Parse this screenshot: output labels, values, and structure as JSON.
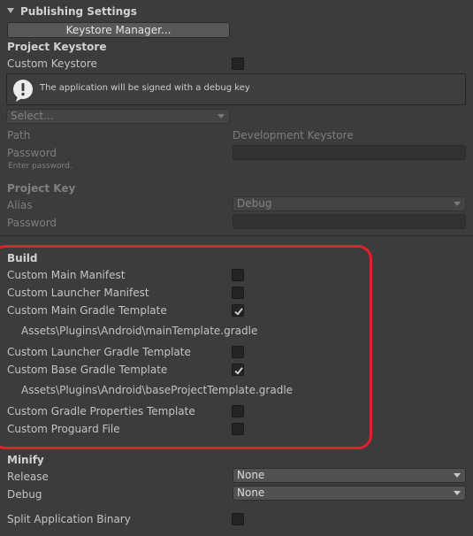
{
  "section": {
    "title": "Publishing Settings",
    "keystore_manager_button": "Keystore Manager..."
  },
  "project_keystore": {
    "heading": "Project Keystore",
    "custom_keystore_label": "Custom Keystore",
    "custom_keystore_checked": false,
    "info_message": "The application will be signed with a debug key",
    "select_value": "Select...",
    "path_label": "Path",
    "path_value": "Development Keystore",
    "password_label": "Password",
    "password_hint": "Enter password."
  },
  "project_key": {
    "heading": "Project Key",
    "alias_label": "Alias",
    "alias_value": "Debug",
    "password_label": "Password"
  },
  "build": {
    "heading": "Build",
    "items": [
      {
        "label": "Custom Main Manifest",
        "checked": false
      },
      {
        "label": "Custom Launcher Manifest",
        "checked": false
      },
      {
        "label": "Custom Main Gradle Template",
        "checked": true
      },
      {
        "label": "Custom Launcher Gradle Template",
        "checked": false
      },
      {
        "label": "Custom Base Gradle Template",
        "checked": true
      },
      {
        "label": "Custom Gradle Properties Template",
        "checked": false
      },
      {
        "label": "Custom Proguard File",
        "checked": false
      }
    ],
    "main_gradle_path": "Assets\\Plugins\\Android\\mainTemplate.gradle",
    "base_gradle_path": "Assets\\Plugins\\Android\\baseProjectTemplate.gradle"
  },
  "minify": {
    "heading": "Minify",
    "release_label": "Release",
    "release_value": "None",
    "debug_label": "Debug",
    "debug_value": "None"
  },
  "split_binary": {
    "label": "Split Application Binary",
    "checked": false
  },
  "colors": {
    "background": "#3c3c3c",
    "highlight_border": "#e0202c",
    "text": "#c4c4c4"
  }
}
